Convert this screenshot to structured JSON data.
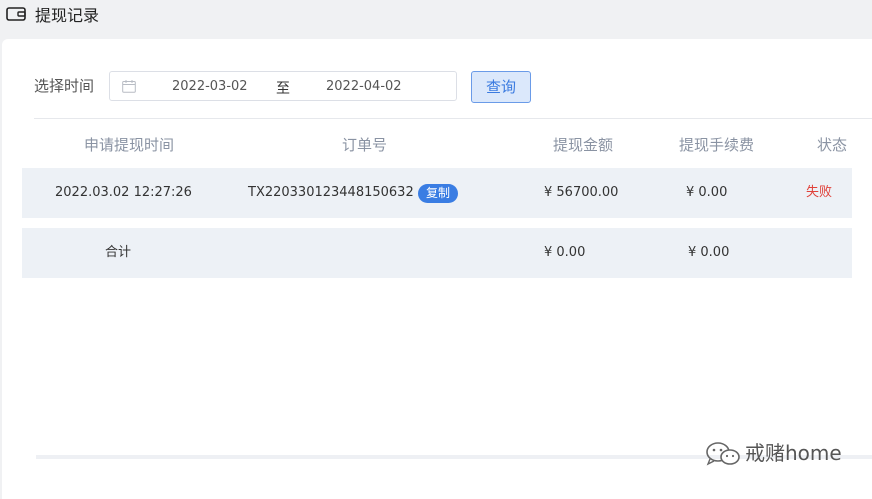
{
  "header": {
    "title": "提现记录",
    "icon": "wallet-icon"
  },
  "filter": {
    "label": "选择时间",
    "start_date": "2022-03-02",
    "separator": "至",
    "end_date": "2022-04-02",
    "query_label": "查询"
  },
  "table": {
    "columns": [
      "申请提现时间",
      "订单号",
      "提现金额",
      "提现手续费",
      "状态"
    ],
    "rows": [
      {
        "time": "2022.03.02 12:27:26",
        "order_no": "TX220330123448150632",
        "copy_label": "复制",
        "amount": "¥ 56700.00",
        "fee": "¥ 0.00",
        "status": "失败"
      }
    ],
    "total": {
      "label": "合计",
      "amount": "¥ 0.00",
      "fee": "¥ 0.00"
    }
  },
  "watermark": {
    "text": "戒赌home"
  },
  "colors": {
    "accent": "#3a7de3",
    "fail": "#e0413a",
    "row_bg": "#edf1f6"
  }
}
